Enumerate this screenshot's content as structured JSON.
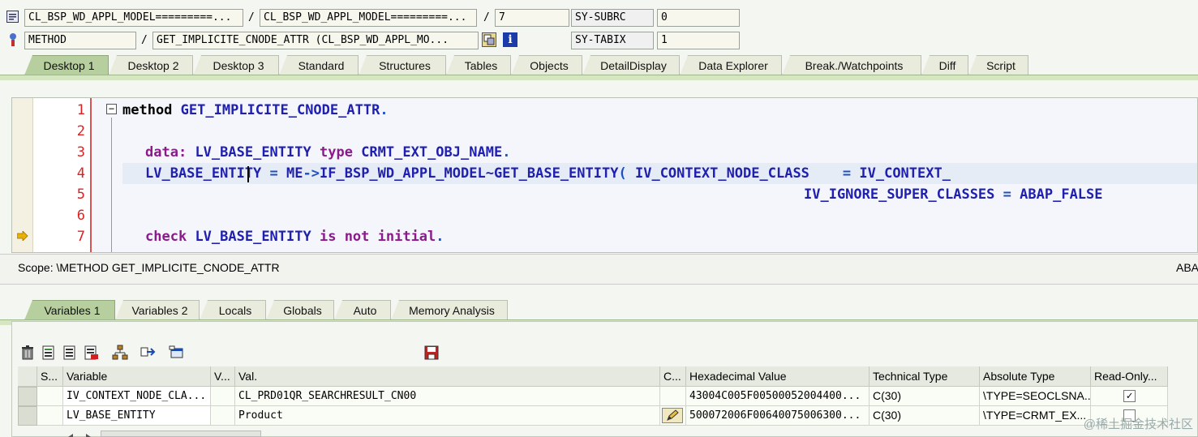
{
  "header": {
    "row1": {
      "obj1": "CL_BSP_WD_APPL_MODEL=========...",
      "obj2": "CL_BSP_WD_APPL_MODEL=========...",
      "line": "7",
      "sys_label": "SY-SUBRC",
      "sys_value": "0"
    },
    "row2": {
      "kind": "METHOD",
      "name": "GET_IMPLICITE_CNODE_ATTR (CL_BSP_WD_APPL_MO...",
      "sys_label": "SY-TABIX",
      "sys_value": "1"
    }
  },
  "main_tabs": [
    "Desktop 1",
    "Desktop 2",
    "Desktop 3",
    "Standard",
    "Structures",
    "Tables",
    "Objects",
    "DetailDisplay",
    "Data Explorer",
    "Break./Watchpoints",
    "Diff",
    "Script"
  ],
  "code": {
    "line_numbers": [
      "1",
      "2",
      "3",
      "4",
      "5",
      "6",
      "7"
    ],
    "line1": {
      "kw": "method",
      "name": "GET_IMPLICITE_CNODE_ATTR",
      "end": "."
    },
    "line3": {
      "kw": "data:",
      "var": "LV_BASE_ENTITY",
      "kw2": "type",
      "type": "CRMT_EXT_OBJ_NAME",
      "end": "."
    },
    "line4": {
      "left": "LV_BASE_ENTITY",
      "eq": "=",
      "me": "ME",
      "arrow": "->",
      "call": "IF_BSP_WD_APPL_MODEL~GET_BASE_ENTITY",
      "paren": "(",
      "param": "IV_CONTEXT_NODE_CLASS",
      "eq2": "=",
      "value": "IV_CONTEXT_"
    },
    "line5": {
      "param": "IV_IGNORE_SUPER_CLASSES",
      "eq": "=",
      "value": "ABAP_FALSE"
    },
    "line7": {
      "kw": "check",
      "var": "LV_BASE_ENTITY",
      "rest": "is not initial",
      "end": "."
    }
  },
  "scope": {
    "text": "Scope: \\METHOD GET_IMPLICITE_CNODE_ATTR",
    "right": "ABA"
  },
  "var_tabs": [
    "Variables 1",
    "Variables 2",
    "Locals",
    "Globals",
    "Auto",
    "Memory Analysis"
  ],
  "table": {
    "columns": [
      "S...",
      "Variable",
      "V...",
      "Val.",
      "C...",
      "Hexadecimal Value",
      "Technical Type",
      "Absolute Type",
      "Read-Only..."
    ],
    "rows": [
      {
        "variable": "IV_CONTEXT_NODE_CLA...",
        "value": "CL_PRD01QR_SEARCHRESULT_CN00",
        "hex": "43004C005F00500052004400...",
        "tech": "C(30)",
        "abs": "\\TYPE=SEOCLSNA...",
        "readonly": "✓"
      },
      {
        "variable": "LV_BASE_ENTITY",
        "value": "Product",
        "hex": "500072006F00640075006300...",
        "tech": "C(30)",
        "abs": "\\TYPE=CRMT_EX..."
      }
    ]
  },
  "watermark": "@稀土掘金技术社区",
  "colors": {
    "keyword": "#8b1a8b",
    "name": "#2020b0",
    "line_number": "#e02020",
    "active_tab": "#b7cf9e"
  }
}
